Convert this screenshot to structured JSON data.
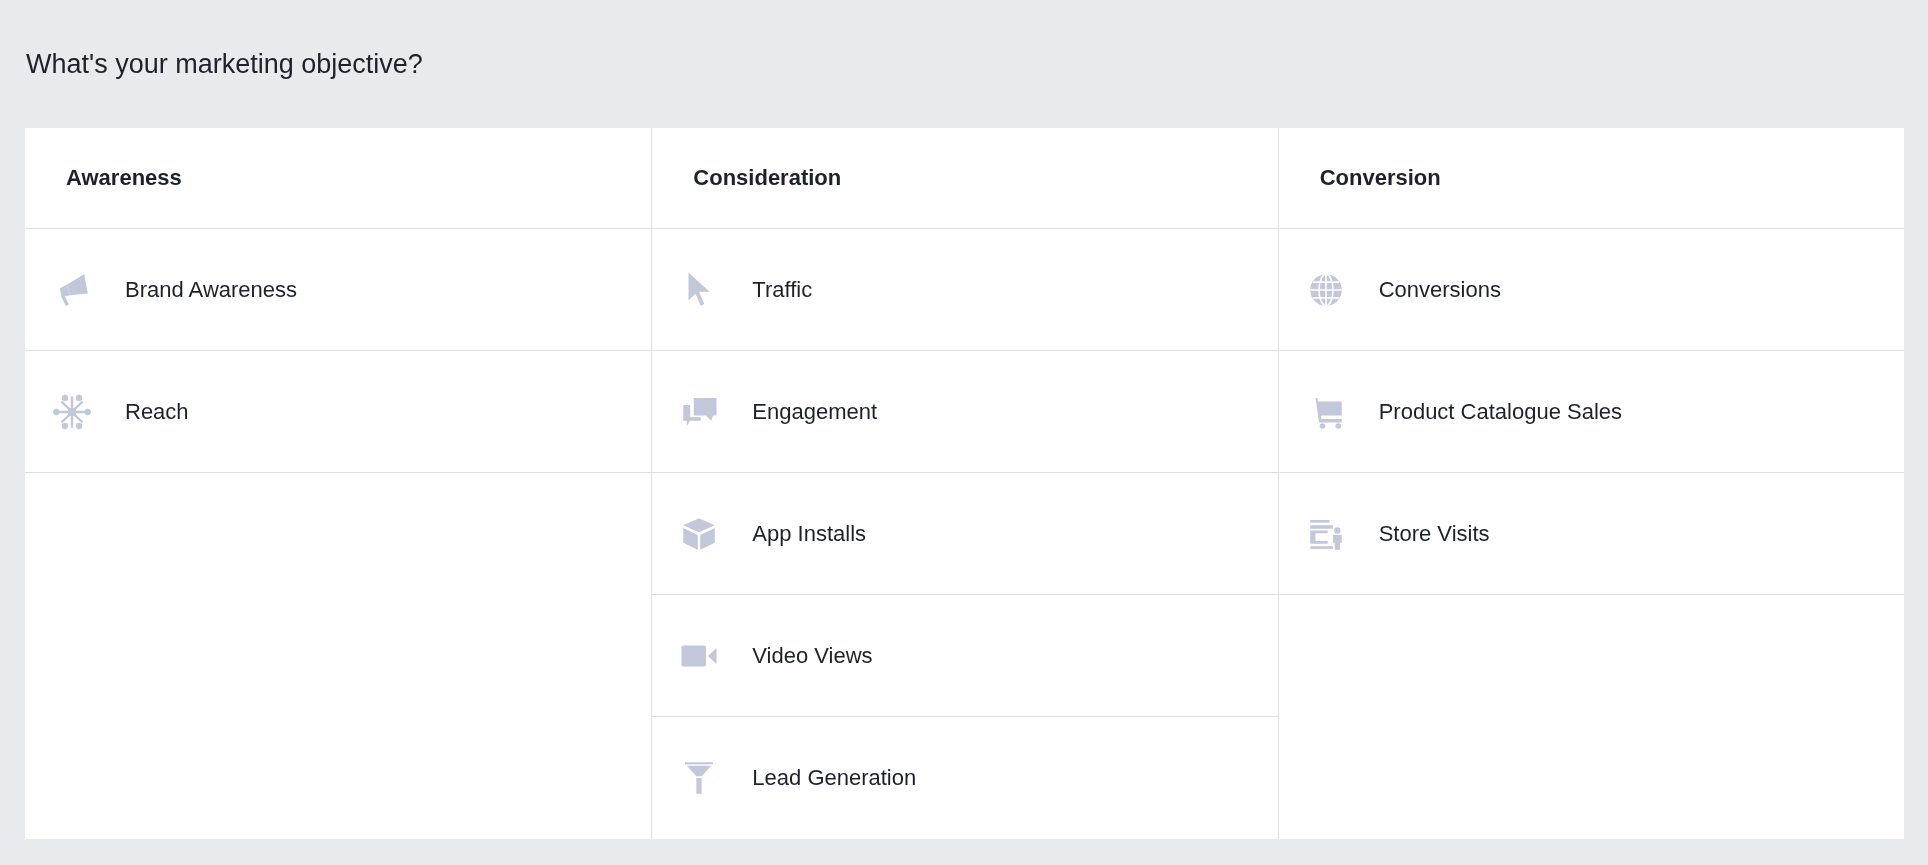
{
  "title": "What's your marketing objective?",
  "columns": [
    {
      "heading": "Awareness",
      "items": [
        {
          "label": "Brand Awareness"
        },
        {
          "label": "Reach"
        }
      ]
    },
    {
      "heading": "Consideration",
      "items": [
        {
          "label": "Traffic"
        },
        {
          "label": "Engagement"
        },
        {
          "label": "App Installs"
        },
        {
          "label": "Video Views"
        },
        {
          "label": "Lead Generation"
        }
      ]
    },
    {
      "heading": "Conversion",
      "items": [
        {
          "label": "Conversions"
        },
        {
          "label": "Product Catalogue Sales"
        },
        {
          "label": "Store Visits"
        }
      ]
    }
  ]
}
